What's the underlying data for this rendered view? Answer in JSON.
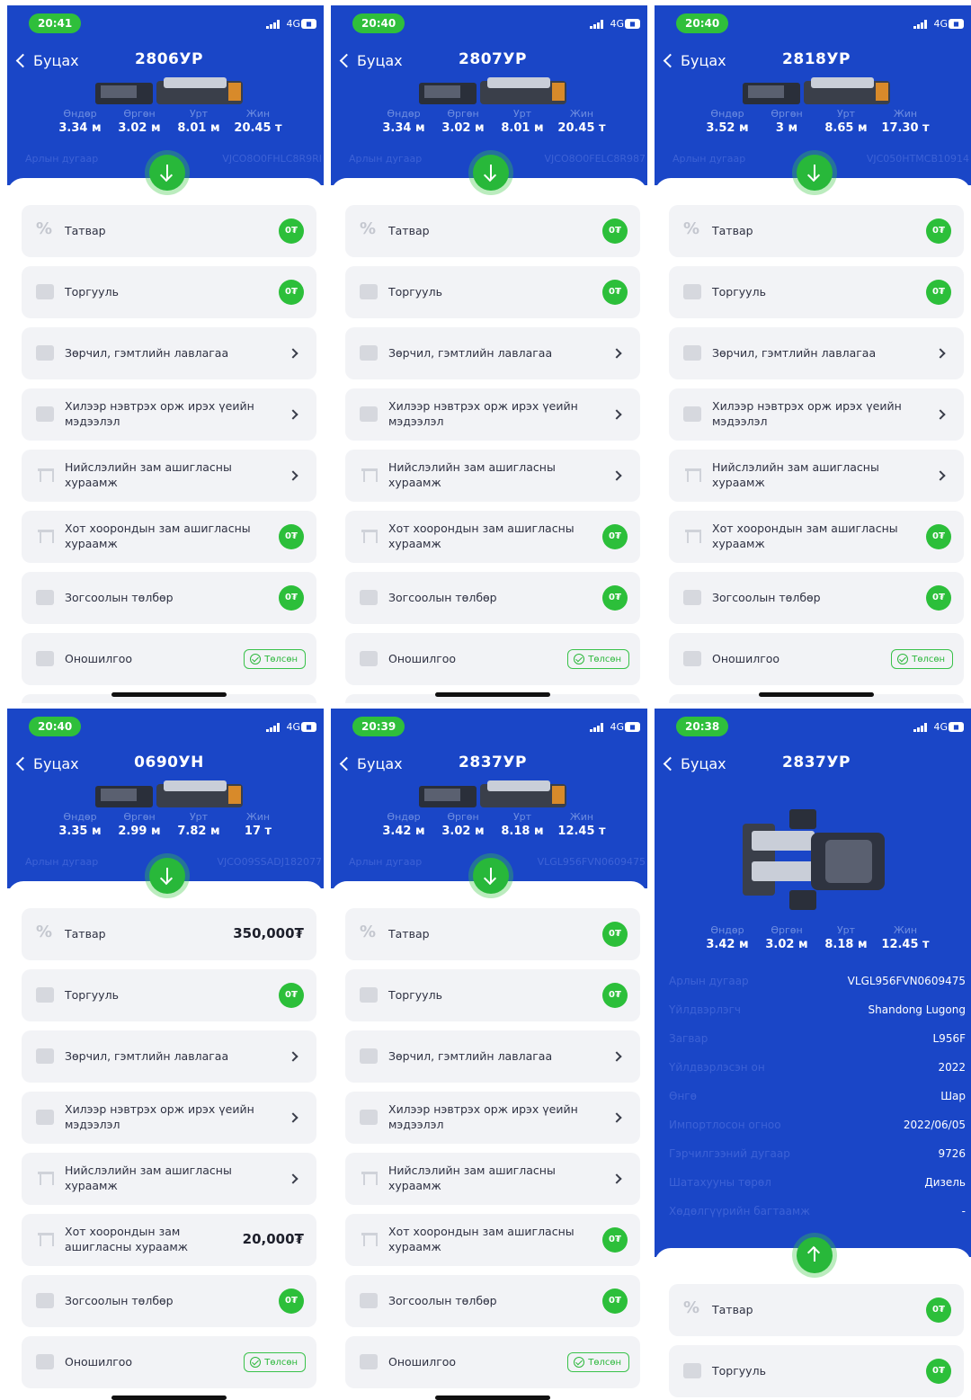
{
  "common": {
    "network": "4G",
    "battery": "4G",
    "back_label": "Буцах",
    "dim_labels": [
      "Өндөр",
      "Өргөн",
      "Урт",
      "Жин"
    ],
    "vin_label": "Арлын дугаар",
    "zero_badge": "0₮",
    "paid_label": "Төлсөн",
    "items": [
      "Татвар",
      "Торгууль",
      "Зөрчил, гэмтлийн лавлагаа",
      "Хилээр нэвтрэх орж ирэх үеийн мэдээлэл",
      "Нийслэлийн зам ашигласны хураамж",
      "Хот хоорондын зам ашигласны хураамж",
      "Зогсоолын төлбөр",
      "Оношилгоо"
    ]
  },
  "screens": [
    {
      "time": "20:41",
      "plate": "2806УР",
      "dims": [
        "3.34 м",
        "3.02 м",
        "8.01 м",
        "20.45 т"
      ],
      "vin": "VJCO8O0FHLC8R9RI",
      "tax": "0₮",
      "intercity": "0₮"
    },
    {
      "time": "20:40",
      "plate": "2807УР",
      "dims": [
        "3.34 м",
        "3.02 м",
        "8.01 м",
        "20.45 т"
      ],
      "vin": "VJCO8O0FELC8R987",
      "tax": "0₮",
      "intercity": "0₮"
    },
    {
      "time": "20:40",
      "plate": "2818УР",
      "dims": [
        "3.52 м",
        "3 м",
        "8.65 м",
        "17.30 т"
      ],
      "vin": "VJC050HTMCB10914",
      "tax": "0₮",
      "intercity": "0₮"
    },
    {
      "time": "20:40",
      "plate": "0690УН",
      "dims": [
        "3.35 м",
        "2.99 м",
        "7.82 м",
        "17 т"
      ],
      "vin": "VJCO09SSADJ182077",
      "tax": "350,000₮",
      "intercity": "20,000₮"
    },
    {
      "time": "20:39",
      "plate": "2837УР",
      "dims": [
        "3.42 м",
        "3.02 м",
        "8.18 м",
        "12.45 т"
      ],
      "vin": "VLGL956FVN0609475",
      "tax": "0₮",
      "intercity": "0₮"
    }
  ],
  "detail": {
    "time": "20:38",
    "plate": "2837УР",
    "dims": [
      "3.42 м",
      "3.02 м",
      "8.18 м",
      "12.45 т"
    ],
    "rows": [
      {
        "label": "Арлын дугаар",
        "value": "VLGL956FVN0609475"
      },
      {
        "label": "Үйлдвэрлэгч",
        "value": "Shandong Lugong"
      },
      {
        "label": "Загвар",
        "value": "L956F"
      },
      {
        "label": "Үйлдвэрлэсэн он",
        "value": "2022"
      },
      {
        "label": "Өнгө",
        "value": "Шар"
      },
      {
        "label": "Импортлосон огноо",
        "value": "2022/06/05"
      },
      {
        "label": "Гэрчилгээний дугаар",
        "value": "9726"
      },
      {
        "label": "Шатахууны төрөл",
        "value": "Дизель"
      },
      {
        "label": "Хөдөлгүүрийн багтаамж",
        "value": "-"
      }
    ]
  },
  "colors": {
    "header_blue": "#1a46c7",
    "accent_green": "#2cbf3a",
    "card_bg": "#f2f3f6"
  }
}
